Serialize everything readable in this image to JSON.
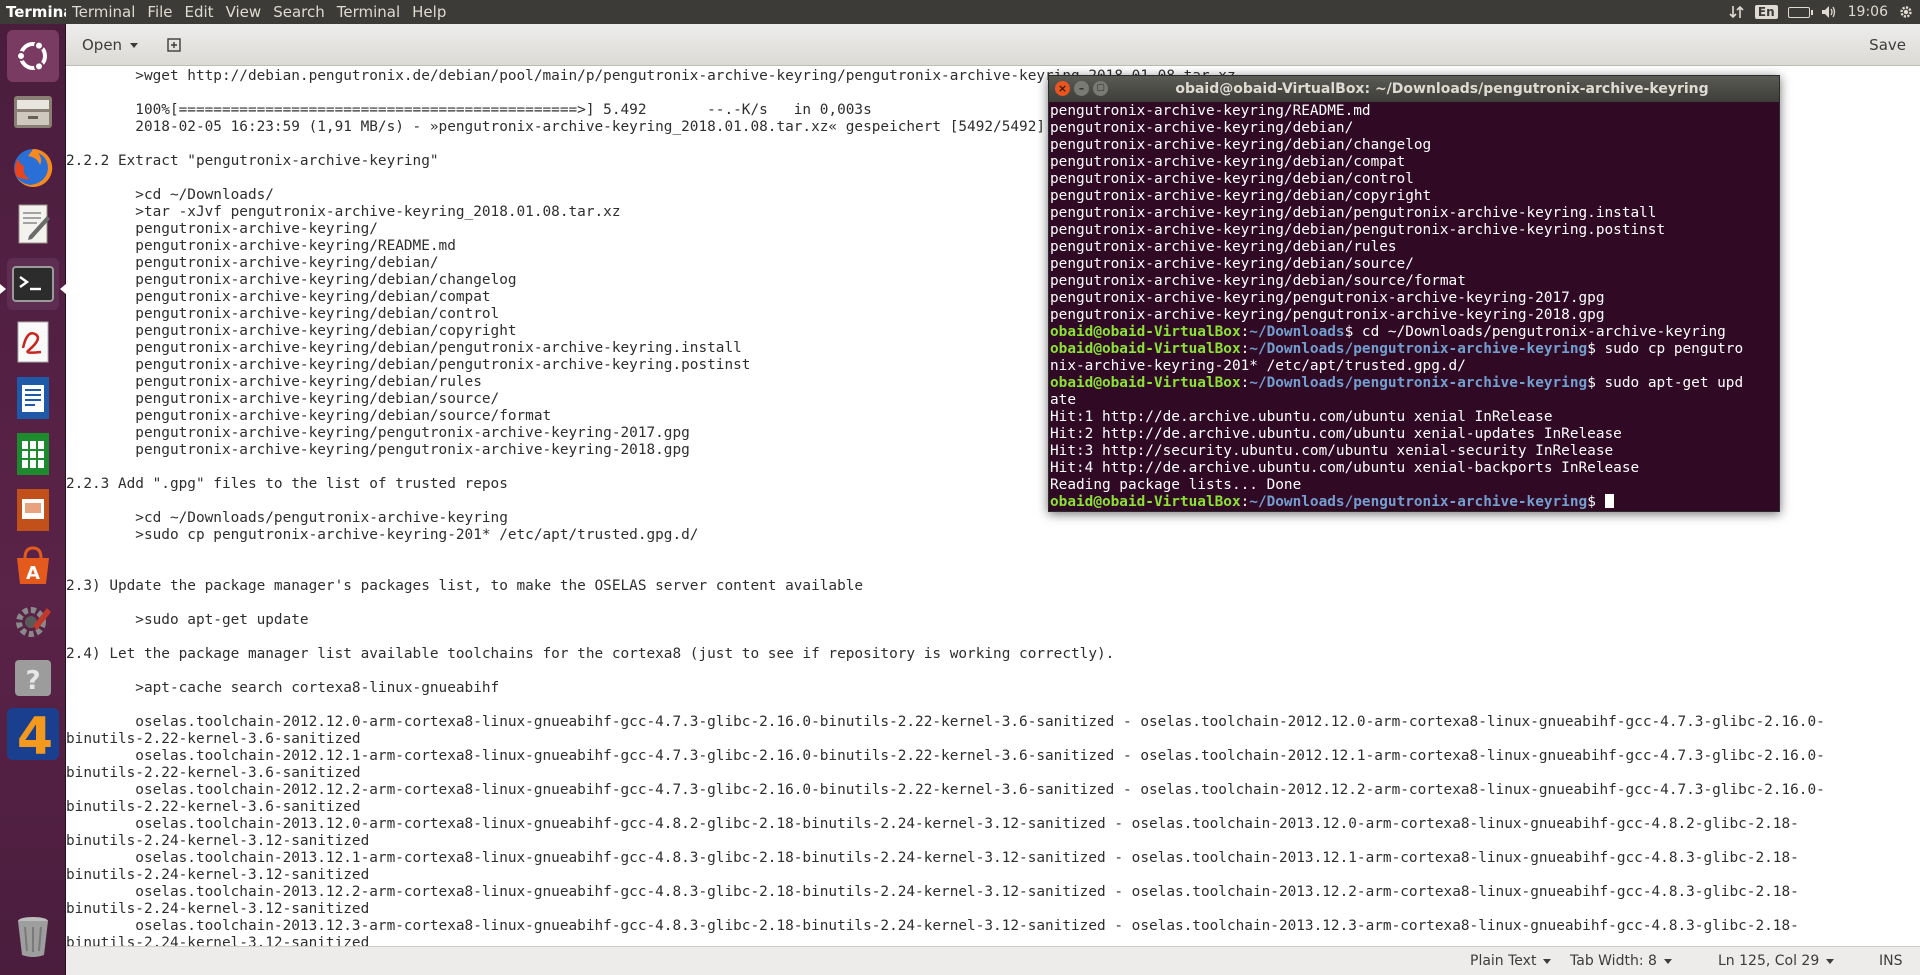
{
  "top_panel": {
    "app_title": "Terminal",
    "menu": [
      "Terminal",
      "File",
      "Edit",
      "View",
      "Search",
      "Terminal",
      "Help"
    ],
    "indicators": {
      "network_icon": "updown-arrows-icon",
      "language": "En",
      "battery_icon": "battery-icon",
      "volume_icon": "speaker-icon",
      "clock": "19:06",
      "system_icon": "gear-icon"
    }
  },
  "launcher": {
    "items": [
      "ubuntu-dash-icon",
      "file-manager-icon",
      "firefox-icon",
      "text-editor-icon",
      "terminal-icon",
      "evince-icon",
      "writer-icon",
      "calc-icon",
      "impress-icon",
      "software-center-icon",
      "settings-icon",
      "help-icon",
      "app-4-icon",
      "trash-icon"
    ]
  },
  "gedit": {
    "open_label": "Open",
    "save_label": "Save",
    "lines": [
      "        >wget http://debian.pengutronix.de/debian/pool/main/p/pengutronix-archive-keyring/pengutronix-archive-keyring_2018.01.08.tar.xz",
      "",
      "        100%[==============================================>] 5.492       --.-K/s   in 0,003s",
      "        2018-02-05 16:23:59 (1,91 MB/s) - »pengutronix-archive-keyring_2018.01.08.tar.xz« gespeichert [5492/5492]",
      "",
      "2.2.2 Extract \"pengutronix-archive-keyring\"",
      "",
      "        >cd ~/Downloads/",
      "        >tar -xJvf pengutronix-archive-keyring_2018.01.08.tar.xz",
      "        pengutronix-archive-keyring/",
      "        pengutronix-archive-keyring/README.md",
      "        pengutronix-archive-keyring/debian/",
      "        pengutronix-archive-keyring/debian/changelog",
      "        pengutronix-archive-keyring/debian/compat",
      "        pengutronix-archive-keyring/debian/control",
      "        pengutronix-archive-keyring/debian/copyright",
      "        pengutronix-archive-keyring/debian/pengutronix-archive-keyring.install",
      "        pengutronix-archive-keyring/debian/pengutronix-archive-keyring.postinst",
      "        pengutronix-archive-keyring/debian/rules",
      "        pengutronix-archive-keyring/debian/source/",
      "        pengutronix-archive-keyring/debian/source/format",
      "        pengutronix-archive-keyring/pengutronix-archive-keyring-2017.gpg",
      "        pengutronix-archive-keyring/pengutronix-archive-keyring-2018.gpg",
      "",
      "2.2.3 Add \".gpg\" files to the list of trusted repos",
      "",
      "        >cd ~/Downloads/pengutronix-archive-keyring",
      "        >sudo cp pengutronix-archive-keyring-201* /etc/apt/trusted.gpg.d/",
      "",
      "",
      "2.3) Update the package manager's packages list, to make the OSELAS server content available",
      "",
      "        >sudo apt-get update",
      "",
      "2.4) Let the package manager list available toolchains for the cortexa8 (just to see if repository is working correctly).",
      "",
      "        >apt-cache search cortexa8-linux-gnueabihf",
      "",
      "        oselas.toolchain-2012.12.0-arm-cortexa8-linux-gnueabihf-gcc-4.7.3-glibc-2.16.0-binutils-2.22-kernel-3.6-sanitized - oselas.toolchain-2012.12.0-arm-cortexa8-linux-gnueabihf-gcc-4.7.3-glibc-2.16.0-",
      "binutils-2.22-kernel-3.6-sanitized",
      "        oselas.toolchain-2012.12.1-arm-cortexa8-linux-gnueabihf-gcc-4.7.3-glibc-2.16.0-binutils-2.22-kernel-3.6-sanitized - oselas.toolchain-2012.12.1-arm-cortexa8-linux-gnueabihf-gcc-4.7.3-glibc-2.16.0-",
      "binutils-2.22-kernel-3.6-sanitized",
      "        oselas.toolchain-2012.12.2-arm-cortexa8-linux-gnueabihf-gcc-4.7.3-glibc-2.16.0-binutils-2.22-kernel-3.6-sanitized - oselas.toolchain-2012.12.2-arm-cortexa8-linux-gnueabihf-gcc-4.7.3-glibc-2.16.0-",
      "binutils-2.22-kernel-3.6-sanitized",
      "        oselas.toolchain-2013.12.0-arm-cortexa8-linux-gnueabihf-gcc-4.8.2-glibc-2.18-binutils-2.24-kernel-3.12-sanitized - oselas.toolchain-2013.12.0-arm-cortexa8-linux-gnueabihf-gcc-4.8.2-glibc-2.18-",
      "binutils-2.24-kernel-3.12-sanitized",
      "        oselas.toolchain-2013.12.1-arm-cortexa8-linux-gnueabihf-gcc-4.8.3-glibc-2.18-binutils-2.24-kernel-3.12-sanitized - oselas.toolchain-2013.12.1-arm-cortexa8-linux-gnueabihf-gcc-4.8.3-glibc-2.18-",
      "binutils-2.24-kernel-3.12-sanitized",
      "        oselas.toolchain-2013.12.2-arm-cortexa8-linux-gnueabihf-gcc-4.8.3-glibc-2.18-binutils-2.24-kernel-3.12-sanitized - oselas.toolchain-2013.12.2-arm-cortexa8-linux-gnueabihf-gcc-4.8.3-glibc-2.18-",
      "binutils-2.24-kernel-3.12-sanitized",
      "        oselas.toolchain-2013.12.3-arm-cortexa8-linux-gnueabihf-gcc-4.8.3-glibc-2.18-binutils-2.24-kernel-3.12-sanitized - oselas.toolchain-2013.12.3-arm-cortexa8-linux-gnueabihf-gcc-4.8.3-glibc-2.18-",
      "binutils-2.24-kernel-3.12-sanitized"
    ]
  },
  "statusbar": {
    "language": "Plain Text",
    "tab_width": "Tab Width: 8",
    "position": "Ln 125, Col 29",
    "mode": "INS"
  },
  "terminal": {
    "title": "obaid@obaid-VirtualBox: ~/Downloads/pengutronix-archive-keyring",
    "output_top": "pengutronix-archive-keyring/README.md\npengutronix-archive-keyring/debian/\npengutronix-archive-keyring/debian/changelog\npengutronix-archive-keyring/debian/compat\npengutronix-archive-keyring/debian/control\npengutronix-archive-keyring/debian/copyright\npengutronix-archive-keyring/debian/pengutronix-archive-keyring.install\npengutronix-archive-keyring/debian/pengutronix-archive-keyring.postinst\npengutronix-archive-keyring/debian/rules\npengutronix-archive-keyring/debian/source/\npengutronix-archive-keyring/debian/source/format\npengutronix-archive-keyring/pengutronix-archive-keyring-2017.gpg\npengutronix-archive-keyring/pengutronix-archive-keyring-2018.gpg",
    "prompt_user": "obaid@obaid-VirtualBox",
    "path_downloads": "~/Downloads",
    "path_keyring": "~/Downloads/pengutronix-archive-keyring",
    "cmd1": "$ cd ~/Downloads/pengutronix-archive-keyring",
    "cmd2": "$ sudo cp pengutro\nnix-archive-keyring-201* /etc/apt/trusted.gpg.d/",
    "cmd3": "$ sudo apt-get upd\nate",
    "output_bottom": "Hit:1 http://de.archive.ubuntu.com/ubuntu xenial InRelease\nHit:2 http://de.archive.ubuntu.com/ubuntu xenial-updates InRelease\nHit:3 http://security.ubuntu.com/ubuntu xenial-security InRelease\nHit:4 http://de.archive.ubuntu.com/ubuntu xenial-backports InRelease\nReading package lists... Done",
    "cmd4": "$ "
  },
  "colors": {
    "terminal_bg": "#300a24",
    "prompt_user": "#8ae234",
    "prompt_path": "#729fcf",
    "launcher_bg": "#4a1d3d",
    "panel_bg": "#3c3b37"
  }
}
